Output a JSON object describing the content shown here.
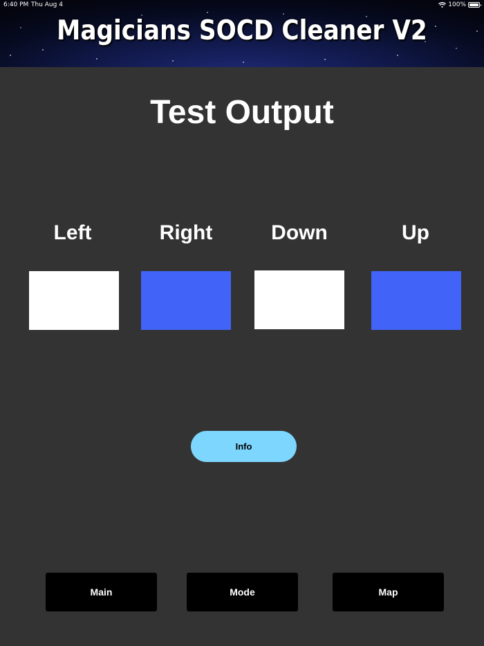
{
  "status_bar": {
    "time": "6:40 PM",
    "date": "Thu Aug 4",
    "battery_text": "100%",
    "wifi_icon": "wifi-icon",
    "battery_icon": "battery-full-icon"
  },
  "banner": {
    "title": "Magicians SOCD Cleaner V2"
  },
  "page": {
    "title": "Test Output"
  },
  "outputs": [
    {
      "label": "Left",
      "state": "off",
      "color": "#ffffff"
    },
    {
      "label": "Right",
      "state": "on",
      "color": "#4163f7"
    },
    {
      "label": "Down",
      "state": "off",
      "color": "#ffffff"
    },
    {
      "label": "Up",
      "state": "on",
      "color": "#4163f7"
    }
  ],
  "info_button": {
    "label": "Info",
    "color": "#7dd6fd"
  },
  "nav": {
    "items": [
      {
        "label": "Main"
      },
      {
        "label": "Mode"
      },
      {
        "label": "Map"
      }
    ]
  },
  "colors": {
    "background": "#333333",
    "active": "#4163f7",
    "inactive": "#ffffff",
    "nav_button": "#000000"
  }
}
